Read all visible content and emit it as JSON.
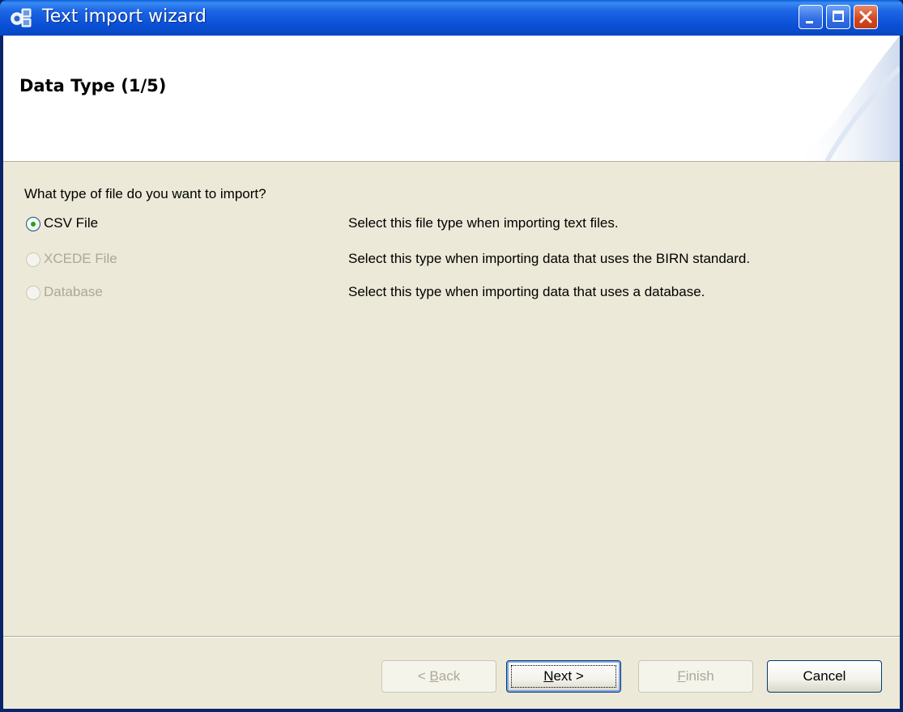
{
  "window": {
    "title": "Text import wizard",
    "icons": {
      "app": "wizard-app-icon",
      "minimize": "minimize-icon",
      "maximize": "maximize-icon",
      "close": "close-icon"
    }
  },
  "header": {
    "page_title": "Data Type (1/5)"
  },
  "body": {
    "question": "What type of file do you want to import?",
    "options": [
      {
        "label": "CSV File",
        "description": "Select this file type when importing text files.",
        "checked": true,
        "enabled": true
      },
      {
        "label": "XCEDE File",
        "description": "Select this type when importing data that uses the BIRN standard.",
        "checked": false,
        "enabled": false
      },
      {
        "label": "Database",
        "description": "Select this type when importing data that uses a database.",
        "checked": false,
        "enabled": false
      }
    ]
  },
  "footer": {
    "back": {
      "prefix": "< ",
      "mnemonic": "B",
      "rest": "ack",
      "enabled": false
    },
    "next": {
      "mnemonic": "N",
      "rest": "ext >",
      "enabled": true
    },
    "finish": {
      "mnemonic": "F",
      "rest": "inish",
      "enabled": false
    },
    "cancel": {
      "label": "Cancel",
      "enabled": true
    }
  },
  "colors": {
    "titlebar": "#0a50d6",
    "dialog_bg": "#ece9d8",
    "disabled_text": "#aca899",
    "radio_checked": "#21a121"
  }
}
